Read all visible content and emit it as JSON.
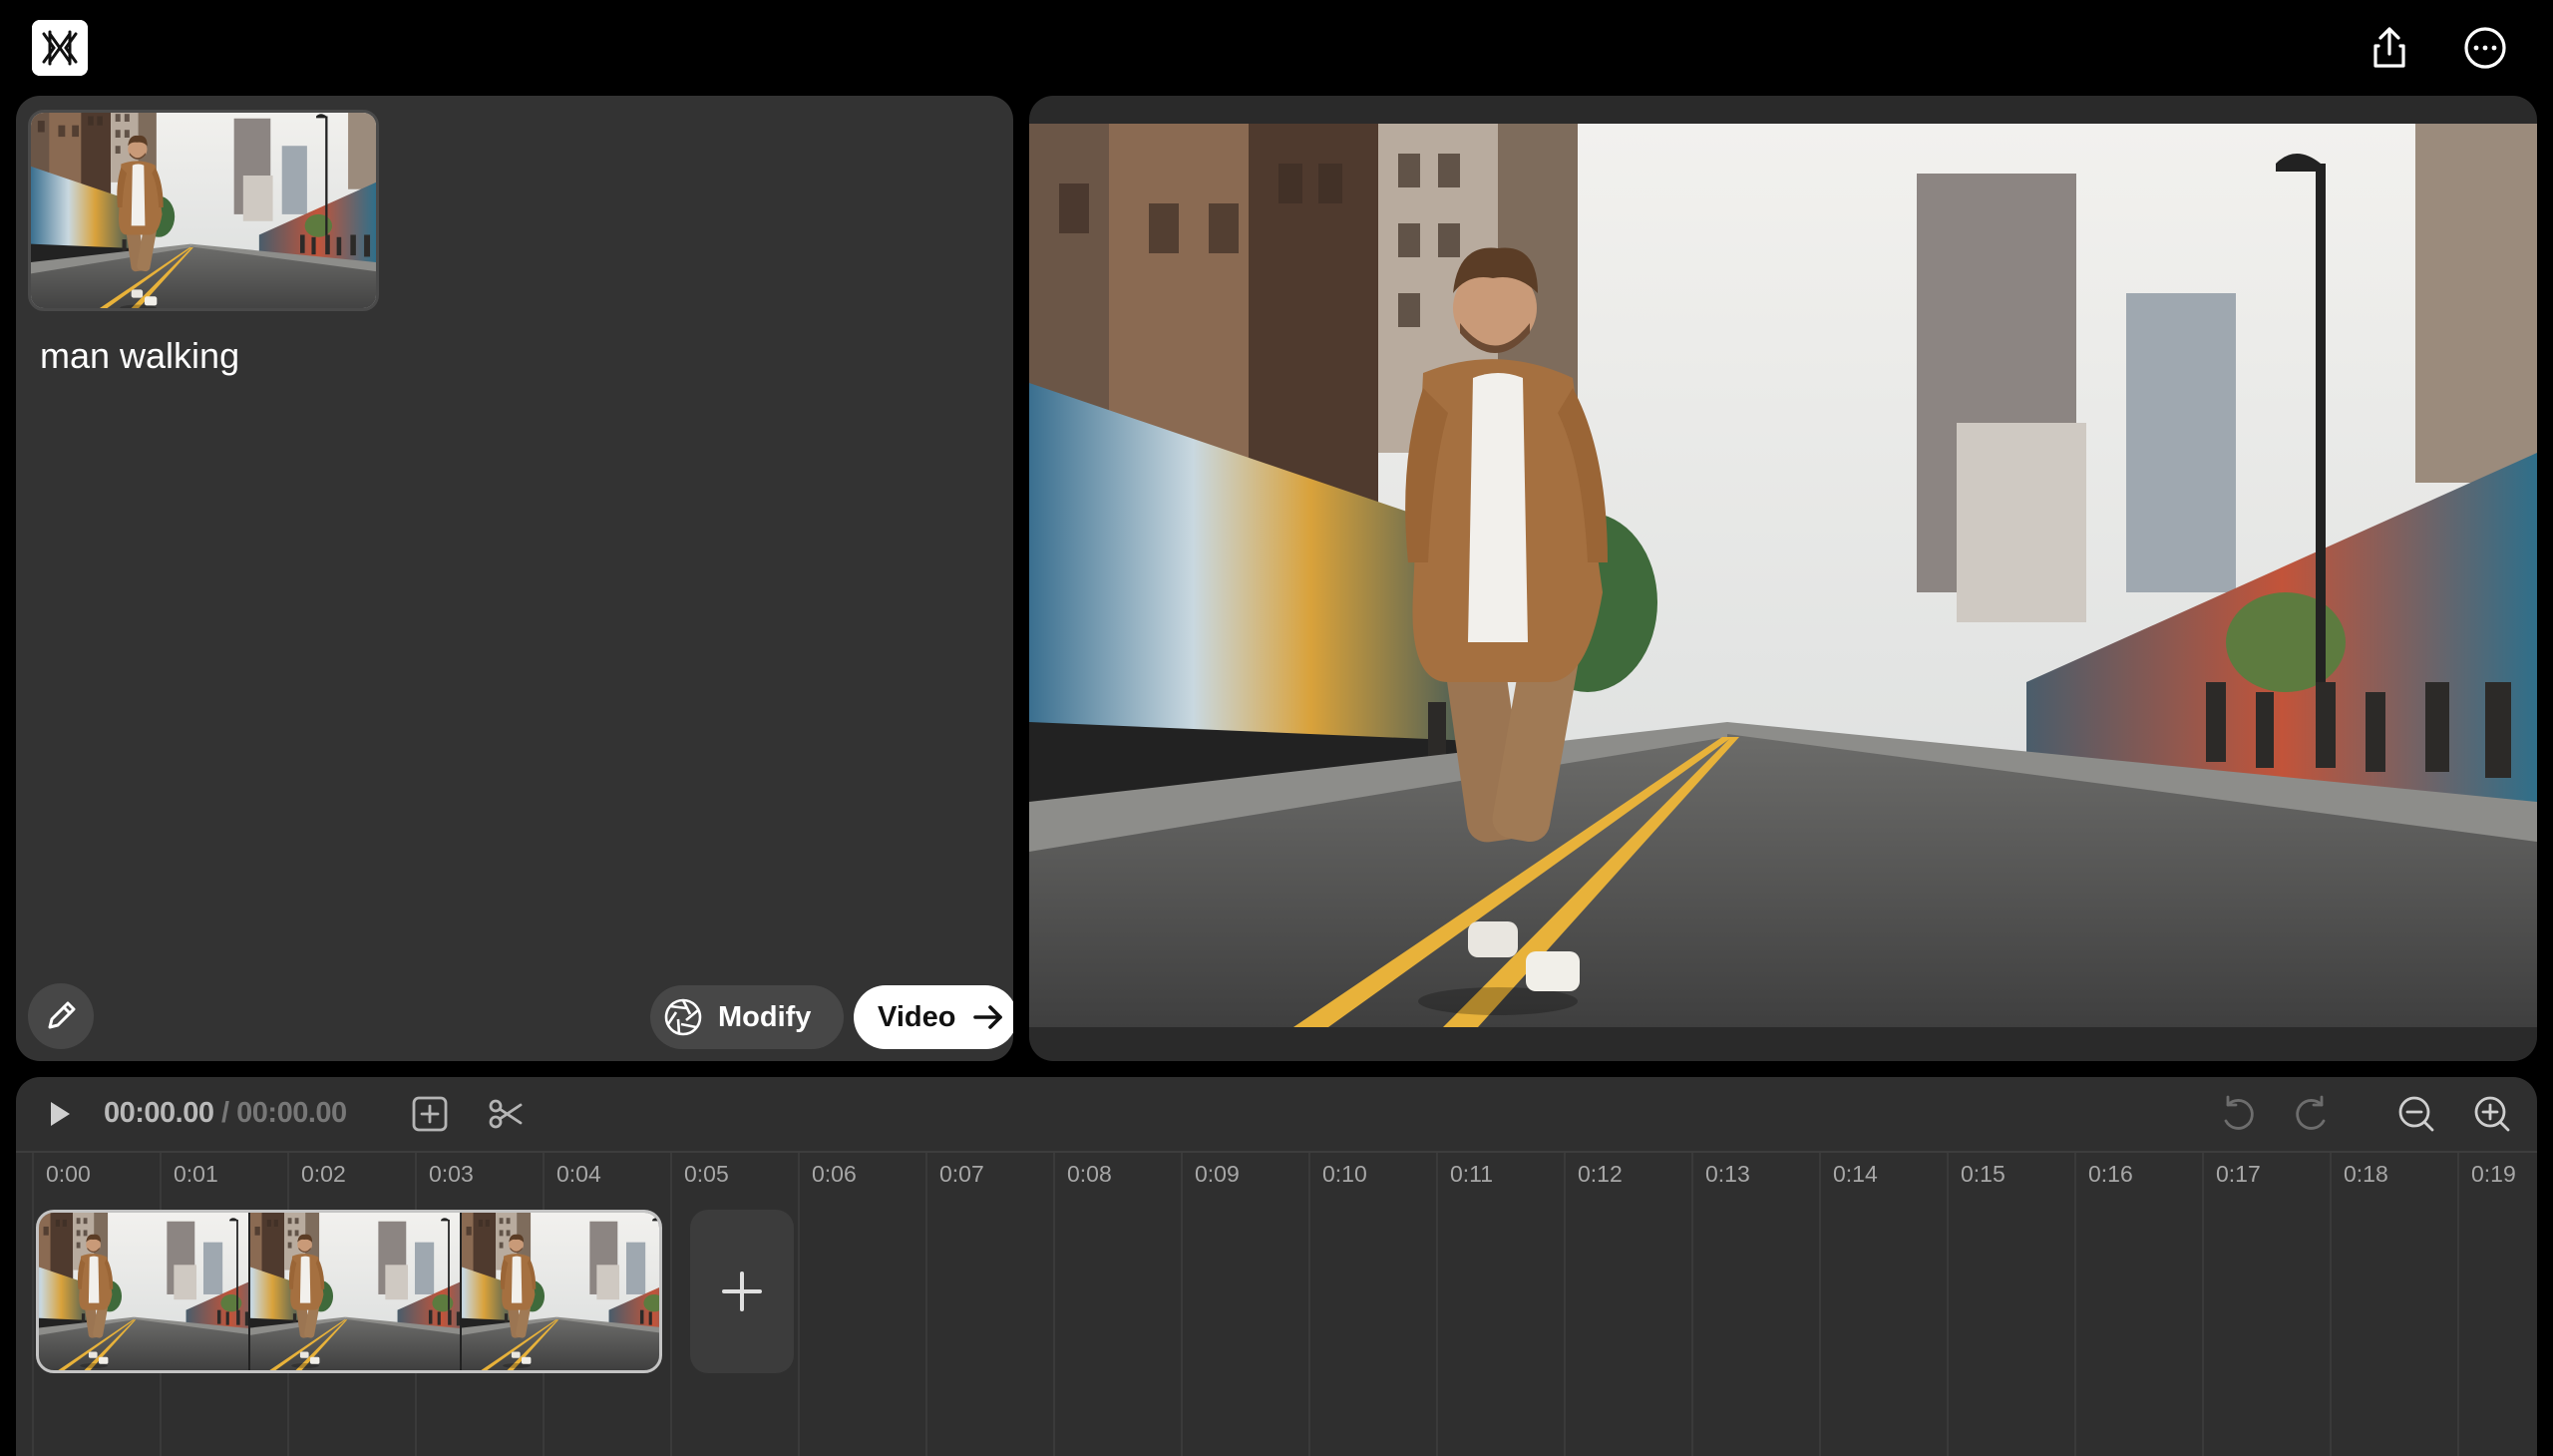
{
  "app": {
    "logo_icon": "app-logo-icon",
    "share_icon": "share-icon",
    "more_icon": "more-options-icon"
  },
  "asset": {
    "title": "man walking",
    "thumbnail_icon": "image-thumbnail"
  },
  "left_panel": {
    "edit_icon": "pencil-icon",
    "modify_label": "Modify",
    "modify_icon": "aperture-icon",
    "video_label": "Video",
    "video_icon": "arrow-right-icon"
  },
  "timeline": {
    "current_time": "00:00.00",
    "separator": " / ",
    "duration": "00:00.00",
    "ticks": [
      "0:00",
      "0:01",
      "0:02",
      "0:03",
      "0:04",
      "0:05",
      "0:06",
      "0:07",
      "0:08",
      "0:09",
      "0:10",
      "0:11",
      "0:12",
      "0:13",
      "0:14",
      "0:15",
      "0:16",
      "0:17",
      "0:18",
      "0:19"
    ],
    "icons": [
      "play-icon",
      "add-frame-icon",
      "scissors-icon",
      "undo-icon",
      "redo-icon",
      "zoom-out-icon",
      "zoom-in-icon"
    ],
    "clip_count": 3
  },
  "colors": {
    "background": "#000000",
    "panel": "#333333",
    "timeline": "#2f2f2f",
    "button_dark": "#474747",
    "button_light": "#ffffff",
    "road_line": "#e8b23a"
  }
}
